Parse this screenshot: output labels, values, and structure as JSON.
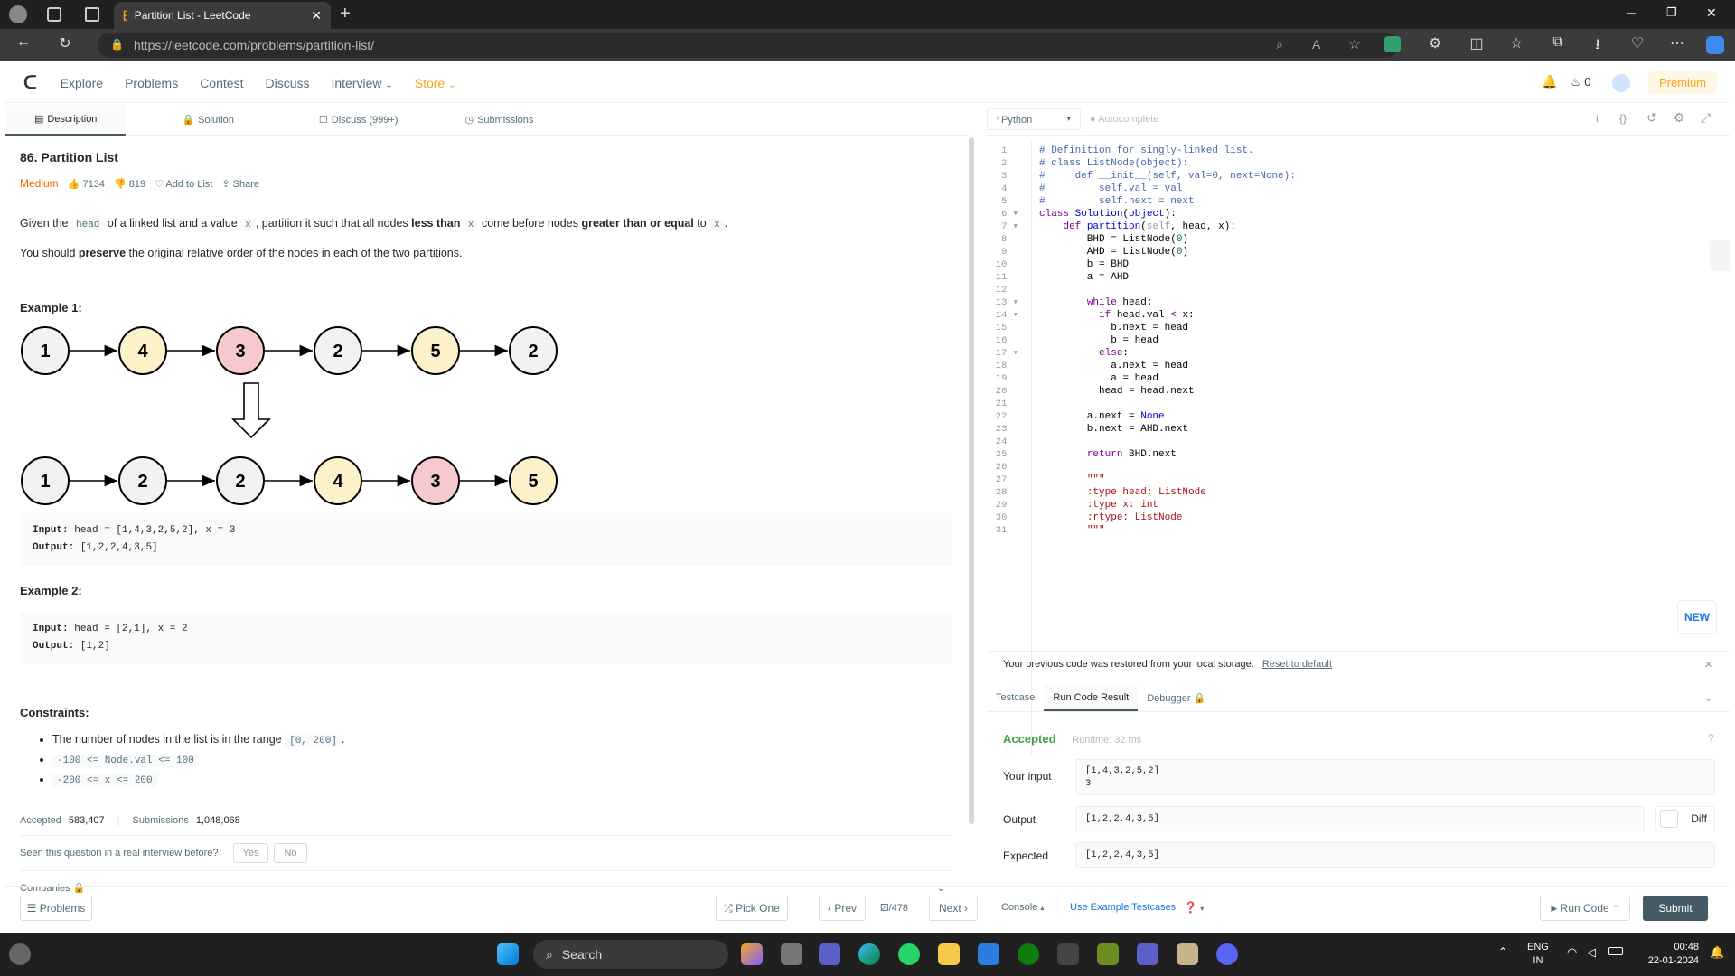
{
  "browser": {
    "tab_title": "Partition List - LeetCode",
    "url": "https://leetcode.com/problems/partition-list/"
  },
  "nav": {
    "items": [
      "Explore",
      "Problems",
      "Contest",
      "Discuss",
      "Interview",
      "Store"
    ],
    "streak": "0",
    "premium": "Premium"
  },
  "left_tabs": [
    "Description",
    "Solution",
    "Discuss (999+)",
    "Submissions"
  ],
  "problem": {
    "title": "86. Partition List",
    "difficulty": "Medium",
    "likes": "7134",
    "dislikes": "819",
    "add_to_list": "Add to List",
    "share": "Share",
    "desc_given": "Given the",
    "desc_head": "head",
    "desc_mid1": "of a linked list and a value",
    "desc_x": "x",
    "desc_mid2": ", partition it such that all nodes",
    "desc_less": "less than",
    "desc_mid3": "come before nodes",
    "desc_greater": "greater than or equal",
    "desc_to": "to",
    "desc_end": ".",
    "desc2_a": "You should",
    "desc2_b": "preserve",
    "desc2_c": "the original relative order of the nodes in each of the two partitions.",
    "example1_title": "Example 1:",
    "diagram_top": [
      "1",
      "4",
      "3",
      "2",
      "5",
      "2"
    ],
    "diagram_bottom": [
      "1",
      "2",
      "2",
      "4",
      "3",
      "5"
    ],
    "ex1_input_label": "Input:",
    "ex1_input": "head = [1,4,3,2,5,2], x = 3",
    "ex1_output_label": "Output:",
    "ex1_output": "[1,2,2,4,3,5]",
    "example2_title": "Example 2:",
    "ex2_input_label": "Input:",
    "ex2_input": "head = [2,1], x = 2",
    "ex2_output_label": "Output:",
    "ex2_output": "[1,2]",
    "constraints_title": "Constraints:",
    "c1_text": "The number of nodes in the list is in the range",
    "c1_code": "[0, 200]",
    "c1_end": ".",
    "c2_code": "-100 <= Node.val <= 100",
    "c3_code": "-200 <= x <= 200",
    "accepted_label": "Accepted",
    "accepted_val": "583,407",
    "submissions_label": "Submissions",
    "submissions_val": "1,048,068",
    "interview_q": "Seen this question in a real interview before?",
    "yes": "Yes",
    "no": "No",
    "companies": "Companies"
  },
  "editor": {
    "language": "Python",
    "autocomplete": "Autocomplete",
    "new_badge": "NEW"
  },
  "restore_msg": "Your previous code was restored from your local storage.",
  "reset_link": "Reset to default",
  "console_tabs": [
    "Testcase",
    "Run Code Result",
    "Debugger"
  ],
  "result": {
    "status": "Accepted",
    "runtime": "Runtime: 32 ms",
    "your_input_label": "Your input",
    "your_input_1": "[1,4,3,2,5,2]",
    "your_input_2": "3",
    "output_label": "Output",
    "output": "[1,2,2,4,3,5]",
    "diff": "Diff",
    "expected_label": "Expected",
    "expected": "[1,2,2,4,3,5]"
  },
  "bottom": {
    "problems": "Problems",
    "pick_one": "Pick One",
    "prev": "Prev",
    "page": "/478",
    "next": "Next",
    "console": "Console",
    "use_example": "Use Example Testcases",
    "run_code": "Run Code",
    "submit": "Submit"
  },
  "taskbar": {
    "search": "Search",
    "lang": "ENG",
    "region": "IN",
    "time": "00:48",
    "date": "22-01-2024"
  },
  "colors": {
    "medium": "#ef6c00",
    "accepted": "#43a047",
    "submit_bg": "#455a64",
    "node_yellow": "#fdf1cc",
    "node_red": "#f6c9cc",
    "node_gray": "#f2f2f2"
  }
}
